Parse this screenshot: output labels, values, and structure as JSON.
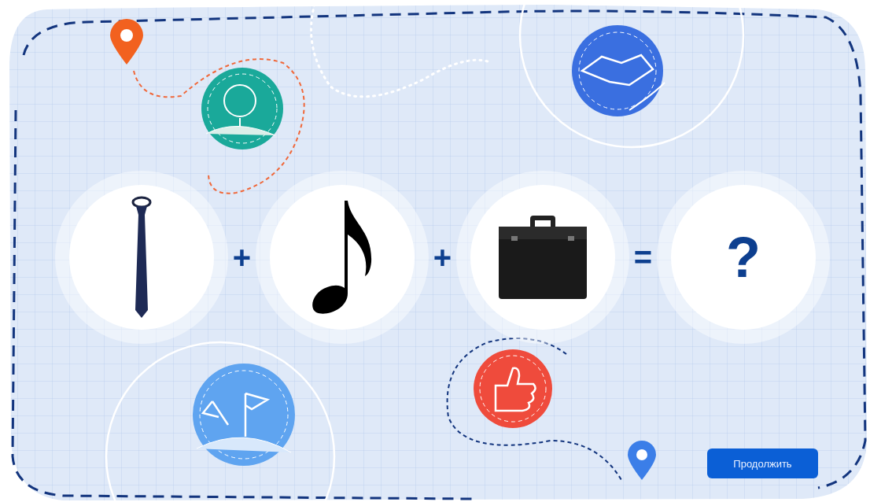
{
  "puzzle": {
    "cards": [
      {
        "kind": "image"
      },
      {
        "kind": "image"
      },
      {
        "kind": "image"
      },
      {
        "kind": "text",
        "text": "?"
      }
    ],
    "operators": [
      "+",
      "+",
      "="
    ]
  },
  "continue_button": {
    "label": "Продолжить"
  }
}
